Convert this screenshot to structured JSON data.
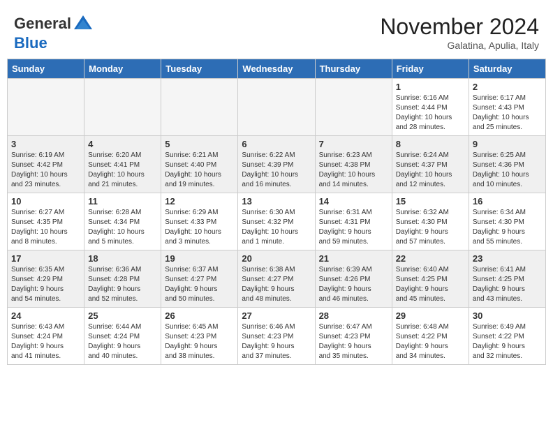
{
  "header": {
    "logo_line1": "General",
    "logo_line2": "Blue",
    "month_title": "November 2024",
    "subtitle": "Galatina, Apulia, Italy"
  },
  "weekdays": [
    "Sunday",
    "Monday",
    "Tuesday",
    "Wednesday",
    "Thursday",
    "Friday",
    "Saturday"
  ],
  "weeks": [
    [
      {
        "day": "",
        "info": ""
      },
      {
        "day": "",
        "info": ""
      },
      {
        "day": "",
        "info": ""
      },
      {
        "day": "",
        "info": ""
      },
      {
        "day": "",
        "info": ""
      },
      {
        "day": "1",
        "info": "Sunrise: 6:16 AM\nSunset: 4:44 PM\nDaylight: 10 hours\nand 28 minutes."
      },
      {
        "day": "2",
        "info": "Sunrise: 6:17 AM\nSunset: 4:43 PM\nDaylight: 10 hours\nand 25 minutes."
      }
    ],
    [
      {
        "day": "3",
        "info": "Sunrise: 6:19 AM\nSunset: 4:42 PM\nDaylight: 10 hours\nand 23 minutes."
      },
      {
        "day": "4",
        "info": "Sunrise: 6:20 AM\nSunset: 4:41 PM\nDaylight: 10 hours\nand 21 minutes."
      },
      {
        "day": "5",
        "info": "Sunrise: 6:21 AM\nSunset: 4:40 PM\nDaylight: 10 hours\nand 19 minutes."
      },
      {
        "day": "6",
        "info": "Sunrise: 6:22 AM\nSunset: 4:39 PM\nDaylight: 10 hours\nand 16 minutes."
      },
      {
        "day": "7",
        "info": "Sunrise: 6:23 AM\nSunset: 4:38 PM\nDaylight: 10 hours\nand 14 minutes."
      },
      {
        "day": "8",
        "info": "Sunrise: 6:24 AM\nSunset: 4:37 PM\nDaylight: 10 hours\nand 12 minutes."
      },
      {
        "day": "9",
        "info": "Sunrise: 6:25 AM\nSunset: 4:36 PM\nDaylight: 10 hours\nand 10 minutes."
      }
    ],
    [
      {
        "day": "10",
        "info": "Sunrise: 6:27 AM\nSunset: 4:35 PM\nDaylight: 10 hours\nand 8 minutes."
      },
      {
        "day": "11",
        "info": "Sunrise: 6:28 AM\nSunset: 4:34 PM\nDaylight: 10 hours\nand 5 minutes."
      },
      {
        "day": "12",
        "info": "Sunrise: 6:29 AM\nSunset: 4:33 PM\nDaylight: 10 hours\nand 3 minutes."
      },
      {
        "day": "13",
        "info": "Sunrise: 6:30 AM\nSunset: 4:32 PM\nDaylight: 10 hours\nand 1 minute."
      },
      {
        "day": "14",
        "info": "Sunrise: 6:31 AM\nSunset: 4:31 PM\nDaylight: 9 hours\nand 59 minutes."
      },
      {
        "day": "15",
        "info": "Sunrise: 6:32 AM\nSunset: 4:30 PM\nDaylight: 9 hours\nand 57 minutes."
      },
      {
        "day": "16",
        "info": "Sunrise: 6:34 AM\nSunset: 4:30 PM\nDaylight: 9 hours\nand 55 minutes."
      }
    ],
    [
      {
        "day": "17",
        "info": "Sunrise: 6:35 AM\nSunset: 4:29 PM\nDaylight: 9 hours\nand 54 minutes."
      },
      {
        "day": "18",
        "info": "Sunrise: 6:36 AM\nSunset: 4:28 PM\nDaylight: 9 hours\nand 52 minutes."
      },
      {
        "day": "19",
        "info": "Sunrise: 6:37 AM\nSunset: 4:27 PM\nDaylight: 9 hours\nand 50 minutes."
      },
      {
        "day": "20",
        "info": "Sunrise: 6:38 AM\nSunset: 4:27 PM\nDaylight: 9 hours\nand 48 minutes."
      },
      {
        "day": "21",
        "info": "Sunrise: 6:39 AM\nSunset: 4:26 PM\nDaylight: 9 hours\nand 46 minutes."
      },
      {
        "day": "22",
        "info": "Sunrise: 6:40 AM\nSunset: 4:25 PM\nDaylight: 9 hours\nand 45 minutes."
      },
      {
        "day": "23",
        "info": "Sunrise: 6:41 AM\nSunset: 4:25 PM\nDaylight: 9 hours\nand 43 minutes."
      }
    ],
    [
      {
        "day": "24",
        "info": "Sunrise: 6:43 AM\nSunset: 4:24 PM\nDaylight: 9 hours\nand 41 minutes."
      },
      {
        "day": "25",
        "info": "Sunrise: 6:44 AM\nSunset: 4:24 PM\nDaylight: 9 hours\nand 40 minutes."
      },
      {
        "day": "26",
        "info": "Sunrise: 6:45 AM\nSunset: 4:23 PM\nDaylight: 9 hours\nand 38 minutes."
      },
      {
        "day": "27",
        "info": "Sunrise: 6:46 AM\nSunset: 4:23 PM\nDaylight: 9 hours\nand 37 minutes."
      },
      {
        "day": "28",
        "info": "Sunrise: 6:47 AM\nSunset: 4:23 PM\nDaylight: 9 hours\nand 35 minutes."
      },
      {
        "day": "29",
        "info": "Sunrise: 6:48 AM\nSunset: 4:22 PM\nDaylight: 9 hours\nand 34 minutes."
      },
      {
        "day": "30",
        "info": "Sunrise: 6:49 AM\nSunset: 4:22 PM\nDaylight: 9 hours\nand 32 minutes."
      }
    ]
  ]
}
